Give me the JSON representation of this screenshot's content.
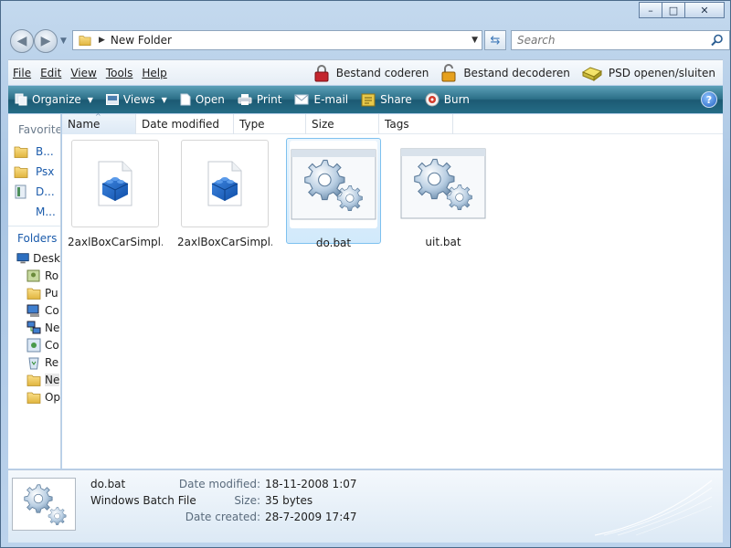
{
  "window": {
    "caption": {
      "minimize": "–",
      "maximize": "□",
      "close": "✕"
    }
  },
  "address": {
    "path": "New Folder",
    "search_placeholder": "Search"
  },
  "menu": [
    "File",
    "Edit",
    "View",
    "Tools",
    "Help"
  ],
  "plugins": [
    {
      "label": "Bestand coderen",
      "icon": "lock-red-icon"
    },
    {
      "label": "Bestand decoderen",
      "icon": "lock-open-icon"
    },
    {
      "label": "PSD openen/sluiten",
      "icon": "drive-icon"
    }
  ],
  "toolbar": {
    "organize": "Organize",
    "views": "Views",
    "open": "Open",
    "print": "Print",
    "email": "E-mail",
    "share": "Share",
    "burn": "Burn",
    "help": "?"
  },
  "navpane": {
    "favorites_heading": "Favorite l",
    "favorites": [
      {
        "label": "B...",
        "icon": "folder-icon"
      },
      {
        "label": "Psx",
        "icon": "folder-icon"
      },
      {
        "label": "D...",
        "icon": "document-icon"
      },
      {
        "label": "M...",
        "icon": ""
      }
    ],
    "folders_heading": "Folders",
    "tree": [
      {
        "label": "Desk",
        "icon": "desktop-icon"
      },
      {
        "label": "Ro",
        "icon": "user-folder-icon"
      },
      {
        "label": "Pu",
        "icon": "folder-icon"
      },
      {
        "label": "Co",
        "icon": "computer-icon"
      },
      {
        "label": "Ne",
        "icon": "network-icon"
      },
      {
        "label": "Co",
        "icon": "control-panel-icon"
      },
      {
        "label": "Re",
        "icon": "recycle-bin-icon"
      },
      {
        "label": "Ne",
        "icon": "folder-icon"
      },
      {
        "label": "Op",
        "icon": "folder-icon"
      }
    ]
  },
  "columns": [
    "Name",
    "Date modified",
    "Type",
    "Size",
    "Tags"
  ],
  "files": [
    {
      "name": "2axlBoxCarSimpl...",
      "icon": "lego-brick-icon"
    },
    {
      "name": "2axlBoxCarSimpl...",
      "icon": "lego-brick-icon"
    },
    {
      "name": "do.bat",
      "icon": "gears-icon"
    },
    {
      "name": "uit.bat",
      "icon": "gears-icon"
    }
  ],
  "details": {
    "name": "do.bat",
    "type": "Windows Batch File",
    "date_modified_label": "Date modified:",
    "date_modified": "18-11-2008 1:07",
    "size_label": "Size:",
    "size": "35 bytes",
    "date_created_label": "Date created:",
    "date_created": "28-7-2009 17:47"
  }
}
